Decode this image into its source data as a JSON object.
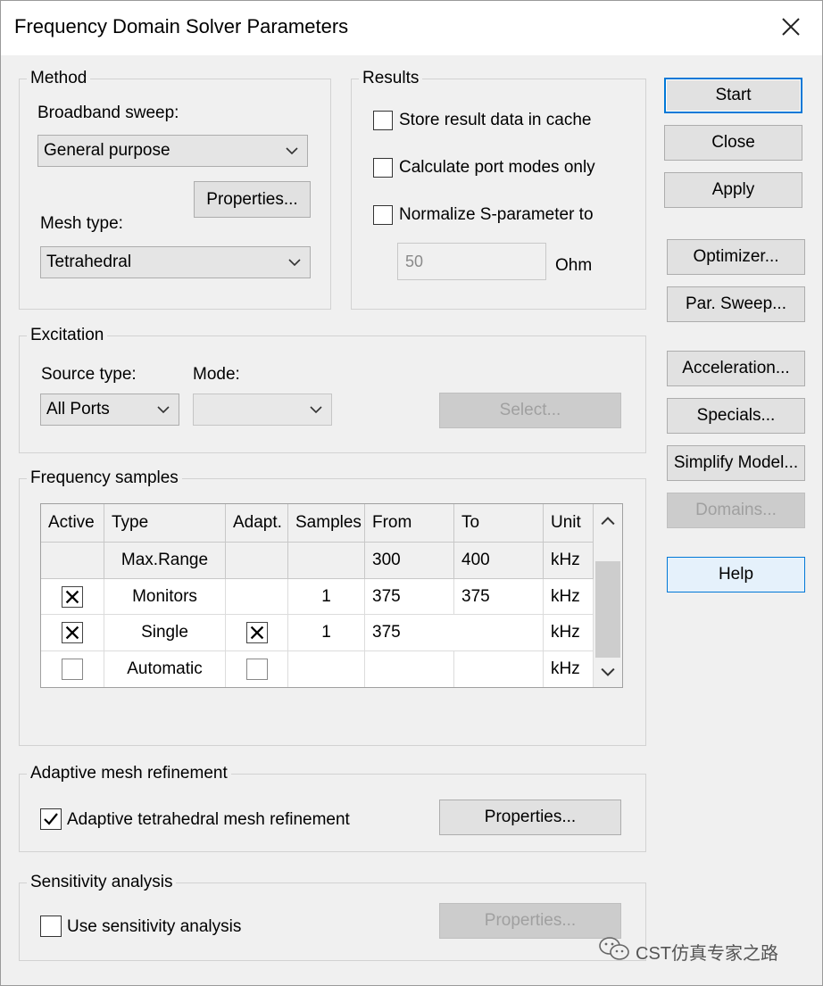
{
  "window": {
    "title": "Frequency Domain Solver Parameters"
  },
  "method": {
    "group_label": "Method",
    "broadband_label": "Broadband sweep:",
    "broadband_value": "General purpose",
    "properties_label": "Properties...",
    "mesh_label": "Mesh type:",
    "mesh_value": "Tetrahedral"
  },
  "results": {
    "group_label": "Results",
    "store_cache": "Store result data in cache",
    "port_modes": "Calculate port modes only",
    "normalize": "Normalize S-parameter to",
    "ohm_value": "50",
    "ohm_unit": "Ohm"
  },
  "excitation": {
    "group_label": "Excitation",
    "source_label": "Source type:",
    "source_value": "All Ports",
    "mode_label": "Mode:",
    "mode_value": "",
    "select_label": "Select..."
  },
  "frequency": {
    "group_label": "Frequency samples",
    "columns": [
      "Active",
      "Type",
      "Adapt.",
      "Samples",
      "From",
      "To",
      "Unit"
    ],
    "rows": [
      {
        "active": "",
        "type": "Max.Range",
        "adapt": "",
        "samples": "",
        "from": "300",
        "to": "400",
        "unit": "kHz",
        "active_state": "none",
        "adapt_state": "none"
      },
      {
        "active": "",
        "type": "Monitors",
        "adapt": "",
        "samples": "1",
        "from": "375",
        "to": "375",
        "unit": "kHz",
        "active_state": "checked",
        "adapt_state": "none"
      },
      {
        "active": "",
        "type": "Single",
        "adapt": "",
        "samples": "1",
        "from": "375",
        "to": "",
        "unit": "kHz",
        "active_state": "checked",
        "adapt_state": "checked"
      },
      {
        "active": "",
        "type": "Automatic",
        "adapt": "",
        "samples": "",
        "from": "",
        "to": "",
        "unit": "kHz",
        "active_state": "unchecked",
        "adapt_state": "unchecked"
      }
    ]
  },
  "adaptive": {
    "group_label": "Adaptive mesh refinement",
    "checkbox_label": "Adaptive tetrahedral mesh refinement",
    "properties_label": "Properties..."
  },
  "sensitivity": {
    "group_label": "Sensitivity analysis",
    "checkbox_label": "Use sensitivity analysis",
    "properties_label": "Properties..."
  },
  "side_buttons": {
    "start": "Start",
    "close": "Close",
    "apply": "Apply",
    "optimizer": "Optimizer...",
    "par_sweep": "Par. Sweep...",
    "acceleration": "Acceleration...",
    "specials": "Specials...",
    "simplify": "Simplify Model...",
    "domains": "Domains...",
    "help": "Help"
  },
  "watermark": {
    "text": "CST仿真专家之路"
  },
  "icons": {
    "close": "close-icon",
    "chevron": "chevron-down-icon",
    "wechat": "wechat-icon"
  }
}
